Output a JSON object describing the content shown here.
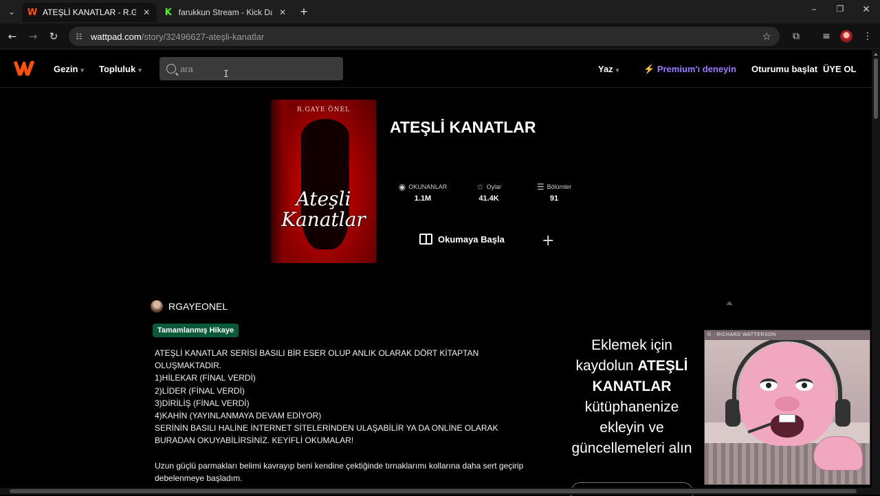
{
  "browser": {
    "tabs": [
      {
        "title": "ATEŞLİ KANATLAR - R.GAYEÖNEL",
        "favicon": "W",
        "favicon_color": "#ff500a",
        "active": true
      },
      {
        "title": "farukkun Stream - Kick Dashboard",
        "favicon": "K",
        "favicon_color": "#53fc18",
        "active": false
      }
    ],
    "new_tab": "+",
    "url_host": "wattpad.com",
    "url_path": "/story/32496627-ateşli-kanatlar"
  },
  "header": {
    "nav": [
      {
        "label": "Gezin"
      },
      {
        "label": "Topluluk"
      }
    ],
    "search_placeholder": "ara",
    "write_label": "Yaz",
    "premium_label": "Premium'ı deneyin",
    "login_label": "Oturumu başlat",
    "signup_label": "ÜYE OL",
    "brand_color": "#ff500a",
    "premium_color": "#9d7bff"
  },
  "story": {
    "title": "ATEŞLİ KANATLAR",
    "cover": {
      "author_text": "R.GAYE ÖNEL",
      "title_text": "Ateşli Kanatlar"
    },
    "stats": [
      {
        "label": "OKUNANLAR",
        "value": "1.1M",
        "icon": "eye-icon"
      },
      {
        "label": "Oylar",
        "value": "41.4K",
        "icon": "star-icon"
      },
      {
        "label": "Bölümler",
        "value": "91",
        "icon": "list-icon"
      }
    ],
    "read_button": "Okumaya Başla",
    "add_button": "+",
    "author": "RGAYEONEL",
    "status_badge": "Tamamlanmış Hikaye",
    "status_color": "#0a5a3a",
    "description": [
      "ATEŞLİ KANATLAR SERİSİ BASILI BİR ESER OLUP ANLIK OLARAK DÖRT KİTAPTAN OLUŞMAKTADIR.",
      "1)HİLEKAR (FİNAL VERDİ)",
      "2)LİDER (FİNAL VERDİ)",
      "3)DİRİLİŞ (FİNAL VERDİ)",
      "4)KAHİN (YAYINLANMAYA DEVAM EDİYOR)",
      "SERİNİN BASILI HALİNE İNTERNET SİTELERİNDEN ULAŞABİLİR YA DA ONLİNE OLARAK BURADAN OKUYABİLİRSİNİZ. KEYİFLİ OKUMALAR!",
      "",
      "Uzun güçlü parmakları belimi kavrayıp beni kendine çektiğinde tırnaklarımı kollarına daha sert geçirip debelenmeye başladım."
    ]
  },
  "sidebar": {
    "signup_prefix": "Eklemek için kaydolun",
    "signup_title": "ATEŞLİ KANATLAR",
    "signup_suffix": "kütüphanenize ekleyin ve güncellemeleri alın"
  },
  "video": {
    "caption": "© - RICHARD WATTERSON"
  }
}
